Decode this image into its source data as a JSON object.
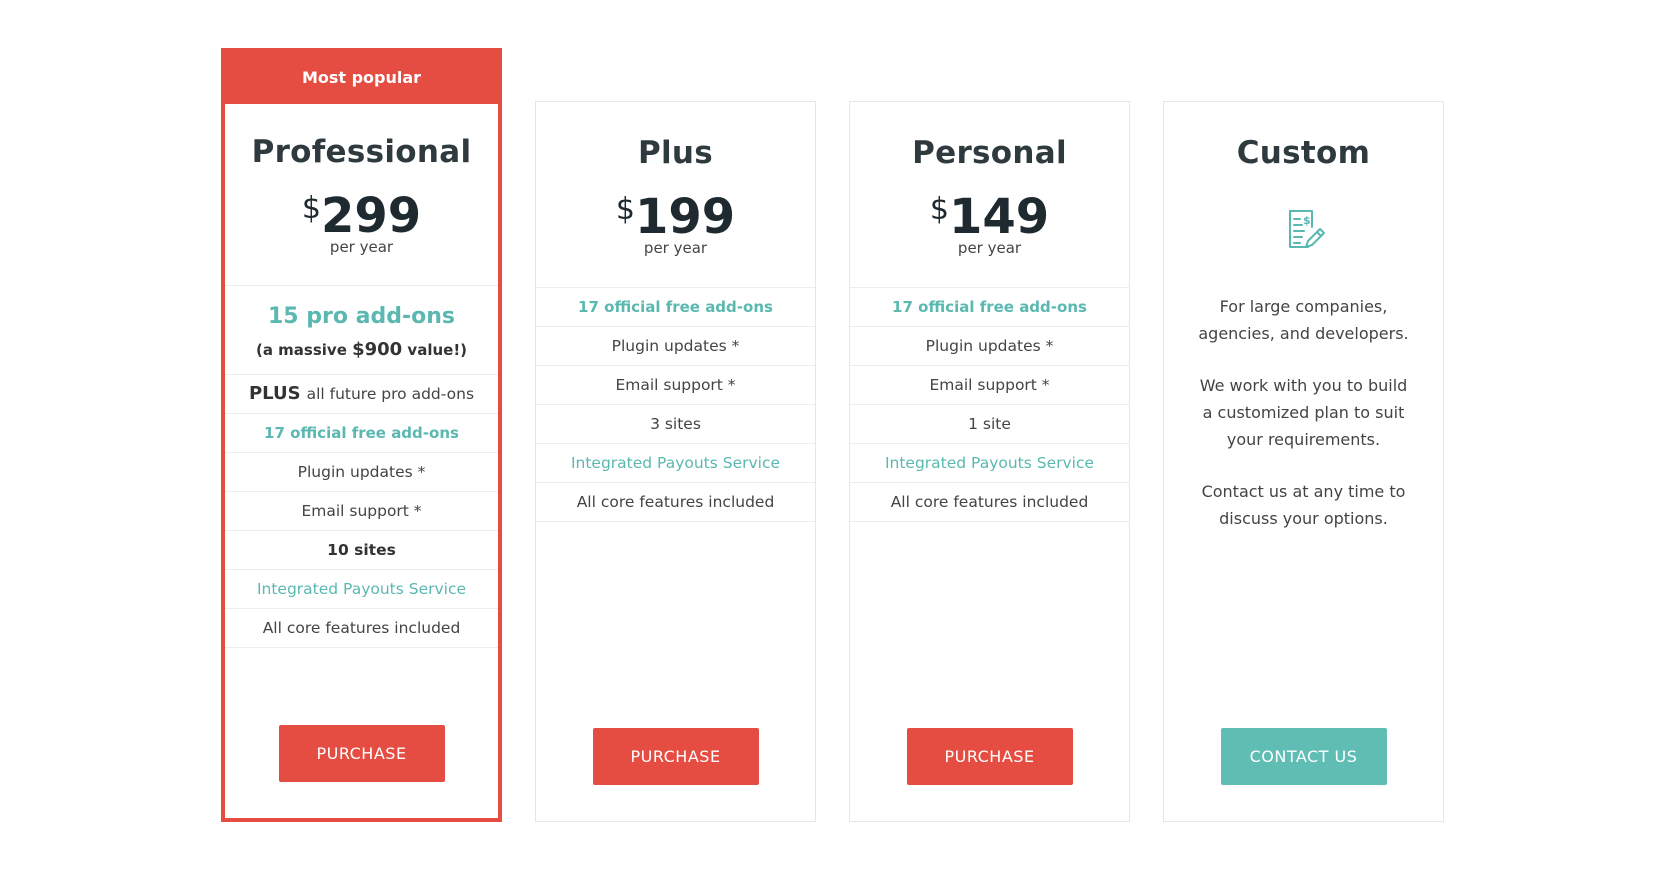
{
  "colors": {
    "accent_red": "#e54d42",
    "accent_teal": "#5ab8b1",
    "button_teal": "#5fbdb4"
  },
  "plans": [
    {
      "banner": "Most popular",
      "name": "Professional",
      "currency": "$",
      "price": "299",
      "period": "per year",
      "addons_title": "15 pro add-ons",
      "addons_sub_pre": "(a massive ",
      "addons_sub_value": "$900",
      "addons_sub_post": " value!)",
      "plus_label": "PLUS",
      "plus_text": "all future pro add-ons",
      "features": [
        "17 official free add-ons",
        "Plugin updates *",
        "Email support *",
        "10 sites",
        "Integrated Payouts Service",
        "All core features included"
      ],
      "button": "PURCHASE"
    },
    {
      "name": "Plus",
      "currency": "$",
      "price": "199",
      "period": "per year",
      "features": [
        "17 official free add-ons",
        "Plugin updates *",
        "Email support *",
        "3 sites",
        "Integrated Payouts Service",
        "All core features included"
      ],
      "button": "PURCHASE"
    },
    {
      "name": "Personal",
      "currency": "$",
      "price": "149",
      "period": "per year",
      "features": [
        "17 official free add-ons",
        "Plugin updates *",
        "Email support *",
        "1 site",
        "Integrated Payouts Service",
        "All core features included"
      ],
      "button": "PURCHASE"
    },
    {
      "name": "Custom",
      "icon": "invoice-pencil-icon",
      "paragraphs": [
        "For large companies, agencies, and developers.",
        "We work with you to build a customized plan to suit your requirements.",
        "Contact us at any time to discuss your options."
      ],
      "button": "CONTACT US"
    }
  ]
}
